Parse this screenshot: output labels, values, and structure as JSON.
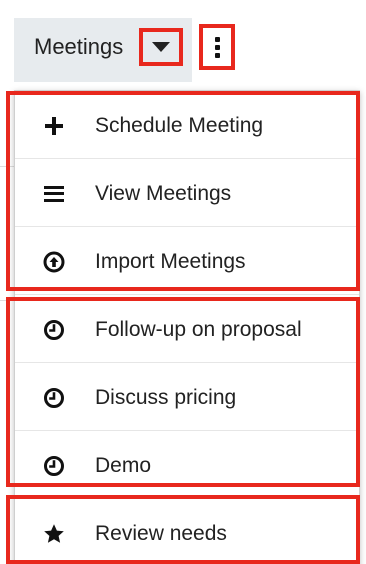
{
  "header": {
    "title": "Meetings",
    "caret_icon": "caret-down-icon",
    "more_icon": "kebab-menu-icon"
  },
  "menu": {
    "actions": [
      {
        "label": "Schedule Meeting",
        "icon": "plus-icon"
      },
      {
        "label": "View Meetings",
        "icon": "list-icon"
      },
      {
        "label": "Import Meetings",
        "icon": "upload-circle-icon"
      }
    ],
    "recent": [
      {
        "label": "Follow-up on proposal",
        "icon": "clock-icon"
      },
      {
        "label": "Discuss pricing",
        "icon": "clock-icon"
      },
      {
        "label": "Demo",
        "icon": "clock-icon"
      }
    ],
    "favorites": [
      {
        "label": "Review needs",
        "icon": "star-icon"
      }
    ]
  },
  "colors": {
    "highlight": "#e8281d",
    "header_bg": "#e7ebee",
    "text": "#222222"
  }
}
